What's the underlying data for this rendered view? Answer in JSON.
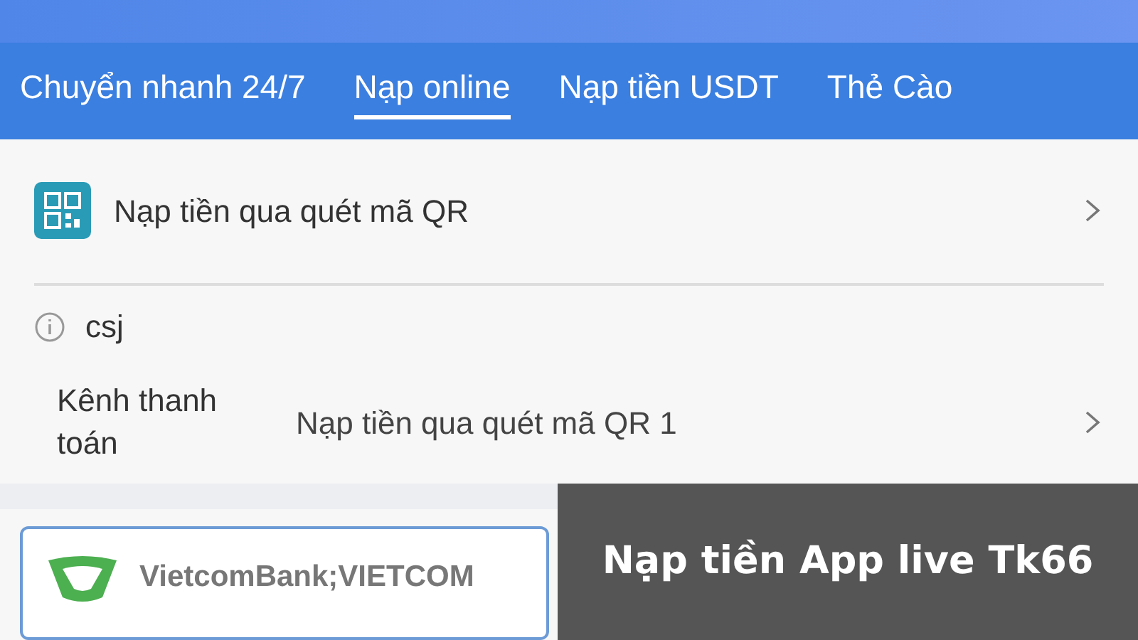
{
  "tabs": [
    {
      "label": "Chuyển nhanh 24/7",
      "selected": false
    },
    {
      "label": "Nạp online",
      "selected": true
    },
    {
      "label": "Nạp tiền USDT",
      "selected": false
    },
    {
      "label": "Thẻ Cào",
      "selected": false
    }
  ],
  "qr_row": {
    "label": "Nạp tiền qua quét mã QR"
  },
  "info": {
    "text": "csj"
  },
  "channel": {
    "label": "Kênh thanh toán",
    "value": "Nạp tiền qua quét mã QR 1"
  },
  "banks": [
    {
      "name": "VietcomBank;VIETCOM",
      "selected": true,
      "kind": "vcb"
    }
  ],
  "caption": "Nạp tiền App live Tk66"
}
